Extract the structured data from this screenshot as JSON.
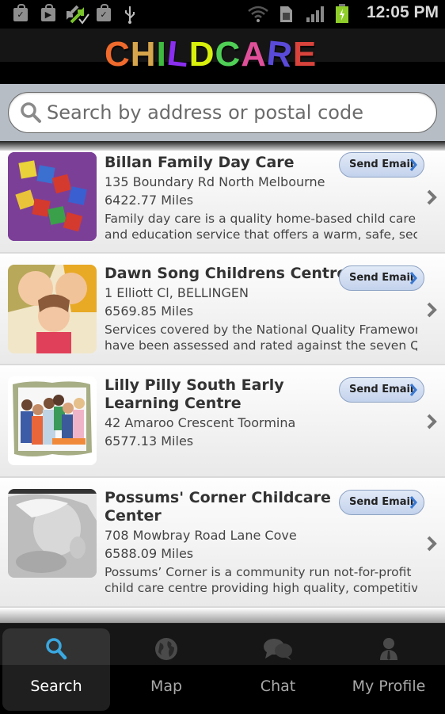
{
  "status_bar": {
    "time": "12:05 PM",
    "left_icons": [
      "market-download-icon",
      "play-store-icon",
      "sync-icon",
      "market-download-icon",
      "usb-icon"
    ],
    "right_icons": [
      "wifi-icon",
      "sim-icon",
      "signal-icon",
      "battery-charging-icon"
    ]
  },
  "header": {
    "logo_letters": [
      {
        "ch": "C",
        "color": "#ef6a2c"
      },
      {
        "ch": "H",
        "color": "#d6a54c"
      },
      {
        "ch": "I",
        "color": "#3fbb3f"
      },
      {
        "ch": "L",
        "color": "#8a2ef0"
      },
      {
        "ch": "D",
        "color": "#d8f00c"
      },
      {
        "ch": "C",
        "color": "#4fcf56"
      },
      {
        "ch": "A",
        "color": "#e0509a"
      },
      {
        "ch": "R",
        "color": "#5a4ad8"
      },
      {
        "ch": "E",
        "color": "#d8433c"
      }
    ]
  },
  "search": {
    "placeholder": "Search by address or postal code",
    "value": ""
  },
  "listings": [
    {
      "name": "Billan Family Day Care",
      "address": "135 Boundary Rd North Melbourne",
      "distance": "6422.77 Miles",
      "description_line1": "Family day care is a quality home-based child care",
      "description_line2": "and education service that offers a warm, safe, sec...",
      "email_label": "Send Email",
      "image": "child-care-blocks"
    },
    {
      "name": "Dawn Song Childrens Centre",
      "address": "1 Elliott Cl, BELLINGEN",
      "distance": "6569.85 Miles",
      "description_line1": "Services covered by the National Quality Framework",
      "description_line2": "have been assessed and rated against the seven Q...",
      "email_label": "Send Email",
      "image": "three-children-photo"
    },
    {
      "name_line1": "Lilly Pilly South Early",
      "name_line2": "Learning Centre",
      "address": "42 Amaroo Crescent Toormina",
      "distance": "6577.13 Miles",
      "email_label": "Send Email",
      "image": "group-of-children-photo"
    },
    {
      "name_line1": "Possums' Corner Childcare",
      "name_line2": "Center",
      "address": "708 Mowbray Road Lane Cove",
      "distance": "6588.09 Miles",
      "description_line1": "Possums’ Corner is a community run not-for-profit",
      "description_line2": "child care centre providing high quality, competitiv...",
      "email_label": "Send Email",
      "image": "mother-and-baby-photo"
    }
  ],
  "tabs": [
    {
      "label": "Search",
      "icon": "search-icon",
      "active": true
    },
    {
      "label": "Map",
      "icon": "globe-icon",
      "active": false
    },
    {
      "label": "Chat",
      "icon": "chat-bubbles-icon",
      "active": false
    },
    {
      "label": "My Profile",
      "icon": "user-icon",
      "active": false
    }
  ],
  "colors": {
    "tab_active_icon": "#3aa8e0",
    "email_button": "#c9d7ef",
    "search_bar_bg": "#b6bdc5"
  }
}
